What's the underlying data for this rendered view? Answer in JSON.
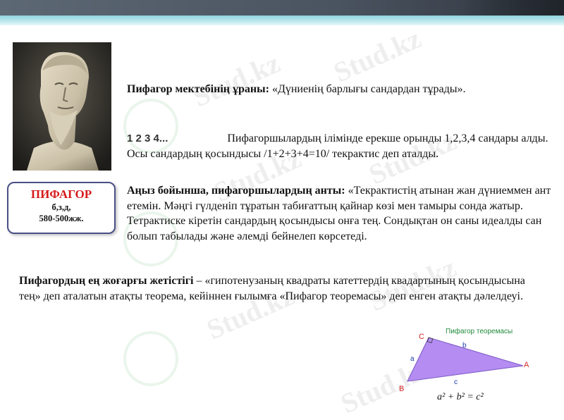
{
  "watermark": "Stud.kz",
  "portrait": {
    "name": "ПИФАГОР",
    "letters": "б,з,д,",
    "years": "580-500жж."
  },
  "motto": {
    "label": "Пифагор мектебінің ұраны:",
    "text": " «Дүниенің барлығы сандардан тұрады»."
  },
  "numbers": {
    "icon": "1 2 3 4...",
    "text": "Пифагоршылардың ілімінде ерекше орынды 1,2,3,4 сандары алды. Осы сандардың қосындысы /1+2+3+4=10/ текрактис деп аталды."
  },
  "oath": {
    "label": "Аңыз бойынша, пифагоршылардың анты:",
    "text": " «Текрактистің атынан жан дүниеммен ант етемін. Мәңгі гүлденіп тұратын табиғаттың қайнар көзі мен тамыры сонда жатыр. Тетрактиске кіретін сандардың қосындысы онға тең. Сондықтан он саны идеалды сан болып табылады және әлемді бейнелеп көрсетеді."
  },
  "achievement": {
    "label": "Пифагордың ең жоғарғы жетістігі",
    "text": " – «гипотенузаның квадраты катеттердің квадартының қосындысына тең» деп аталатын атақты теорема, кейіннен ғылымға «Пифагор теоремасы» деп енген атақты дәлелдеуі."
  },
  "diagram": {
    "title": "Пифагор теоремасы",
    "vertex_a": "A",
    "vertex_b": "B",
    "vertex_c": "C",
    "side_a": "a",
    "side_b": "b",
    "side_c": "c",
    "formula": "a² + b² = c²",
    "fill_color": "#b48cf2"
  }
}
